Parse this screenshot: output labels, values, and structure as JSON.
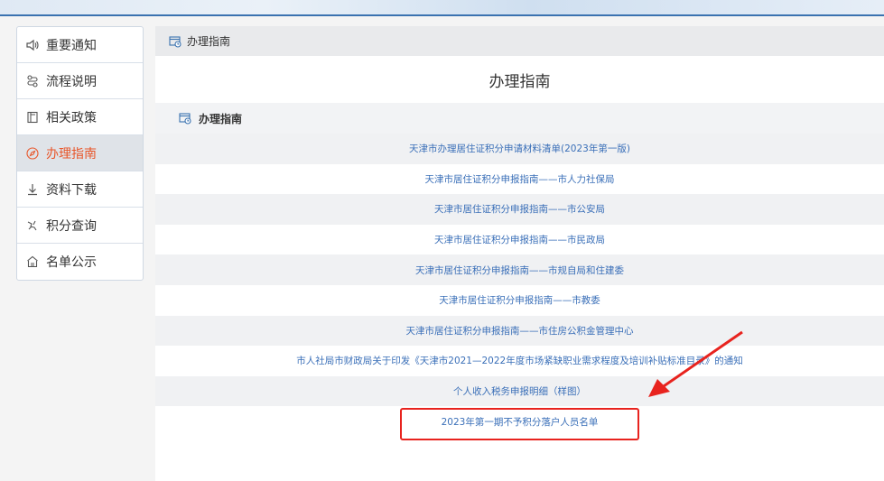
{
  "sidebar": {
    "items": [
      {
        "label": "重要通知",
        "icon": "speaker-icon",
        "active": false
      },
      {
        "label": "流程说明",
        "icon": "flow-icon",
        "active": false
      },
      {
        "label": "相关政策",
        "icon": "policy-icon",
        "active": false
      },
      {
        "label": "办理指南",
        "icon": "compass-icon",
        "active": true
      },
      {
        "label": "资料下载",
        "icon": "download-icon",
        "active": false
      },
      {
        "label": "积分查询",
        "icon": "query-icon",
        "active": false
      },
      {
        "label": "名单公示",
        "icon": "notice-icon",
        "active": false
      }
    ]
  },
  "breadcrumb": {
    "label": "办理指南"
  },
  "page": {
    "title": "办理指南"
  },
  "section": {
    "title": "办理指南"
  },
  "guides": [
    "天津市办理居住证积分申请材料清单(2023年第一版)",
    "天津市居住证积分申报指南——市人力社保局",
    "天津市居住证积分申报指南——市公安局",
    "天津市居住证积分申报指南——市民政局",
    "天津市居住证积分申报指南——市规自局和住建委",
    "天津市居住证积分申报指南——市教委",
    "天津市居住证积分申报指南——市住房公积金管理中心",
    "市人社局市财政局关于印发《天津市2021—2022年度市场紧缺职业需求程度及培训补贴标准目录》的通知",
    "个人收入税务申报明细（样图）",
    "2023年第一期不予积分落户人员名单"
  ],
  "colors": {
    "accent": "#e8562a",
    "link": "#3a6fb8",
    "highlight": "#e8231e"
  }
}
